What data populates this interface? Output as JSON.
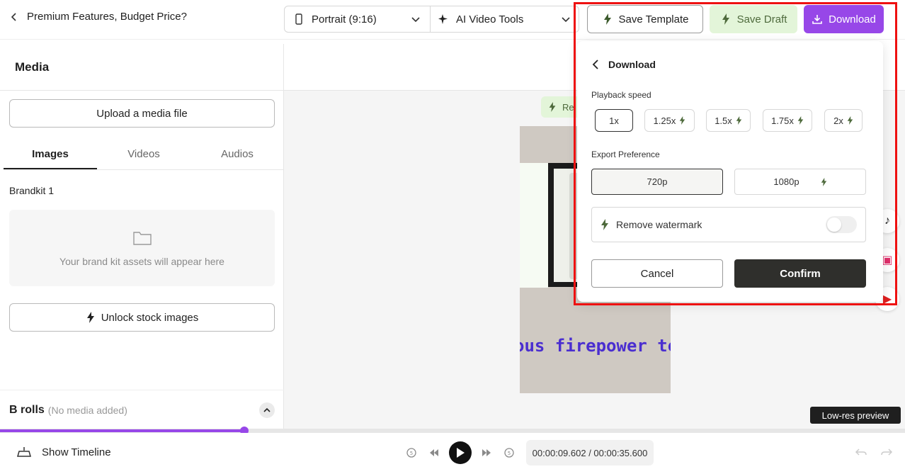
{
  "header": {
    "back_label": "Premium Features, Budget Price?",
    "orientation_select": "Portrait (9:16)",
    "ai_tools_select": "AI Video Tools",
    "save_template": "Save Template",
    "save_draft": "Save Draft",
    "download": "Download"
  },
  "sidebar": {
    "title": "Media",
    "upload_button": "Upload a media file",
    "tabs": [
      "Images",
      "Videos",
      "Audios"
    ],
    "active_tab": "Images",
    "brandkit_title": "Brandkit 1",
    "brandkit_empty": "Your brand kit assets will appear here",
    "unlock_button": "Unlock stock images",
    "brolls_title": "B rolls",
    "brolls_subtitle": "(No media added)"
  },
  "canvas": {
    "regenerate_pill": "Re",
    "caption_text": "ous firepower to",
    "lowres_badge": "Low-res preview"
  },
  "download_panel": {
    "title": "Download",
    "playback_label": "Playback speed",
    "speeds": [
      "1x",
      "1.25x",
      "1.5x",
      "1.75x",
      "2x"
    ],
    "selected_speed": "1x",
    "export_label": "Export Preference",
    "resolutions": [
      "720p",
      "1080p"
    ],
    "selected_resolution": "720p",
    "watermark_label": "Remove watermark",
    "watermark_enabled": false,
    "cancel": "Cancel",
    "confirm": "Confirm"
  },
  "playback": {
    "show_timeline": "Show Timeline",
    "timecode": "00:00:09.602 / 00:00:35.600",
    "progress_fraction": 0.27
  },
  "colors": {
    "accent_purple": "#9747e8",
    "draft_green": "#e3f5d9",
    "highlight_red": "#ee1111",
    "confirm_dark": "#2f2f2c"
  }
}
